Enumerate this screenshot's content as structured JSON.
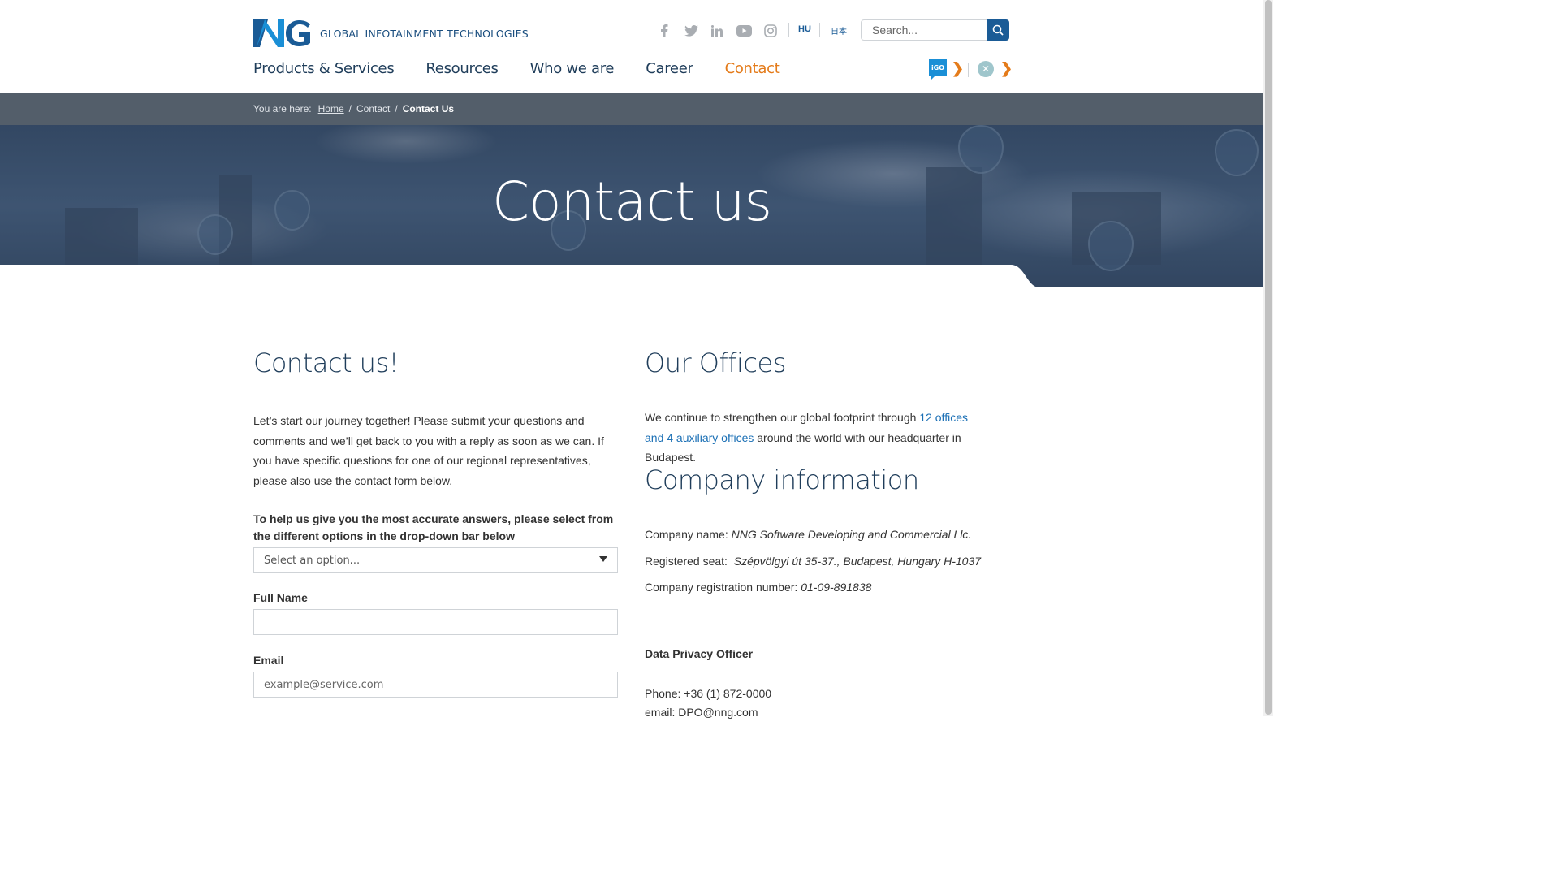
{
  "header": {
    "tagline": "GLOBAL INFOTAINMENT TECHNOLOGIES",
    "social_icons": [
      "facebook-icon",
      "twitter-icon",
      "linkedin-icon",
      "youtube-icon",
      "instagram-icon"
    ],
    "languages": [
      "HU",
      "日本"
    ],
    "search_placeholder": "Search..."
  },
  "nav": {
    "items": [
      "Products & Services",
      "Resources",
      "Who we are",
      "Career",
      "Contact"
    ],
    "active": "Contact",
    "accent_color": "#e47b1a"
  },
  "breadcrumb": {
    "prefix": "You are here:",
    "items": [
      "Home",
      "Contact",
      "Contact Us"
    ]
  },
  "hero": {
    "title": "Contact us"
  },
  "contact": {
    "heading": "Contact us!",
    "intro": "Let’s start our journey together! Please submit your questions and comments and we’ll get back to you with a reply as soon as we can. If you have specific questions for one of our regional representatives, please also use the contact form below.",
    "select_label": "To help us give you the most accurate answers, please select from the different options in the drop-down bar below",
    "select_value": "Select an option...",
    "full_name_label": "Full Name",
    "full_name_value": "",
    "email_label": "Email",
    "email_placeholder": "example@service.com"
  },
  "offices": {
    "heading": "Our Offices",
    "text_before": "We continue to strengthen our global footprint through",
    "link_text": "12 offices and 4 auxiliary offices",
    "text_after": "around the world with our headquarter in Budapest."
  },
  "company": {
    "heading": "Company information",
    "name_label": "Company name:",
    "name_value": "NNG Software Developing and Commercial Llc.",
    "seat_label": "Registered seat:",
    "seat_value": "Szépvölgyi út 35-37., Budapest, Hungary H-1037",
    "reg_label": "Company registration number:",
    "reg_value": "01-09-891838",
    "dpo_heading": "Data Privacy Officer",
    "phone": "Phone: +36 (1) 872-0000",
    "email": "email: DPO@nng.com"
  }
}
